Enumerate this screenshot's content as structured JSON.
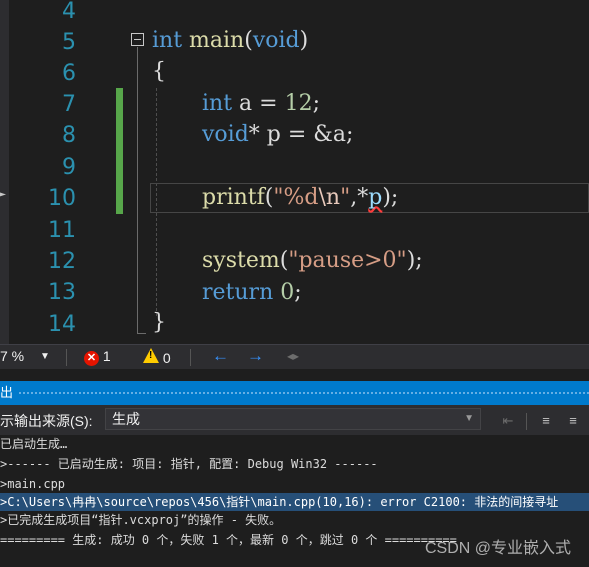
{
  "editor": {
    "line_numbers": [
      "4",
      "5",
      "6",
      "7",
      "8",
      "9",
      "10",
      "11",
      "12",
      "13",
      "14"
    ],
    "lines": {
      "l5": {
        "kw": "int",
        "fn": "main",
        "p1": "(",
        "kw2": "void",
        "p2": ")"
      },
      "l6": {
        "brace": "{"
      },
      "l7": {
        "kw": "int",
        "rest": " a = ",
        "num": "12",
        "end": ";"
      },
      "l8": {
        "kw": "void",
        "rest": "* p = &a;"
      },
      "l10": {
        "fn": "printf",
        "p1": "(",
        "str1": "\"%d",
        "esc": "\\n",
        "str2": "\"",
        "mid": ",*",
        "var": "p",
        "end": ");"
      },
      "l12": {
        "fn": "system",
        "p1": "(",
        "str": "\"pause>0\"",
        "end": ");"
      },
      "l13": {
        "kw": "return",
        "rest": " ",
        "num": "0",
        "end": ";"
      },
      "l14": {
        "brace": "}"
      }
    }
  },
  "status": {
    "zoom": "7 %",
    "errors": "1",
    "warnings": "0"
  },
  "output": {
    "title": "出",
    "source_label": "示输出来源(S):",
    "source_value": "生成",
    "lines": [
      "已启动生成…",
      ">------ 已启动生成: 项目: 指针, 配置: Debug Win32 ------",
      ">main.cpp",
      ">C:\\Users\\冉冉\\source\\repos\\456\\指针\\main.cpp(10,16): error C2100: 非法的间接寻址",
      ">已完成生成项目“指针.vcxproj”的操作 - 失败。",
      "========= 生成: 成功 0 个，失败 1 个，最新 0 个，跳过 0 个 =========="
    ]
  },
  "watermark": "CSDN @专业嵌入式",
  "colors": {
    "accent": "#007acc",
    "editor_bg": "#1e1e1e",
    "keyword": "#569cd6",
    "line_number": "#2b91af",
    "error": "#e51400",
    "warning": "#ffcc00",
    "selection": "#264f78"
  },
  "icons": [
    "error-icon",
    "warning-icon",
    "nav-back-icon",
    "nav-forward-icon",
    "collapse-icon",
    "find-message-icon",
    "align-left-icon",
    "align-right-icon"
  ]
}
